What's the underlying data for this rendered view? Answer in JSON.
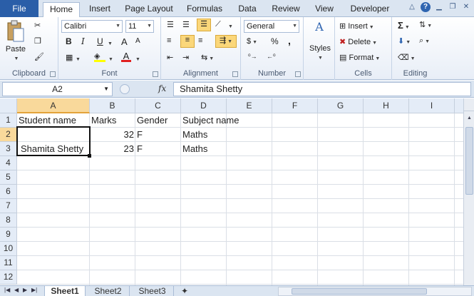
{
  "tabs": [
    "File",
    "Home",
    "Insert",
    "Page Layout",
    "Formulas",
    "Data",
    "Review",
    "View",
    "Developer"
  ],
  "ribbon": {
    "clipboard": {
      "label": "Clipboard",
      "paste": "Paste"
    },
    "font": {
      "label": "Font",
      "name": "Calibri",
      "size": "11",
      "bold": "B",
      "italic": "I",
      "underline": "U",
      "grow": "A",
      "shrink": "A",
      "font_color": "A"
    },
    "alignment": {
      "label": "Alignment"
    },
    "number": {
      "label": "Number",
      "format": "General",
      "percent": "%",
      "comma": ","
    },
    "styles": {
      "label": "Styles"
    },
    "cells": {
      "label": "Cells",
      "insert": "Insert",
      "delete": "Delete",
      "format": "Format"
    },
    "editing": {
      "label": "Editing",
      "sum": "Σ"
    }
  },
  "formula_bar": {
    "name_box": "A2",
    "fx": "fx",
    "value": "Shamita Shetty"
  },
  "columns": [
    "A",
    "B",
    "C",
    "D",
    "E",
    "F",
    "G",
    "H",
    "I"
  ],
  "rows": [
    "1",
    "2",
    "3",
    "4",
    "5",
    "6",
    "7",
    "8",
    "9",
    "10",
    "11",
    "12"
  ],
  "cells": {
    "A1": "Student name",
    "B1": "Marks",
    "C1": "Gender",
    "D1": "Subject name",
    "B2": "32",
    "C2": "F",
    "D2": "Maths",
    "A3": "Shamita Shetty",
    "B3": "23",
    "C3": "F",
    "D3": "Maths"
  },
  "sheets": [
    "Sheet1",
    "Sheet2",
    "Sheet3"
  ],
  "active_sheet": "Sheet1",
  "active_cell": "A2",
  "colors": {
    "file_tab": "#2a5ea8",
    "selected_header": "#f9d99b",
    "highlight_button": "#fbd77a"
  }
}
